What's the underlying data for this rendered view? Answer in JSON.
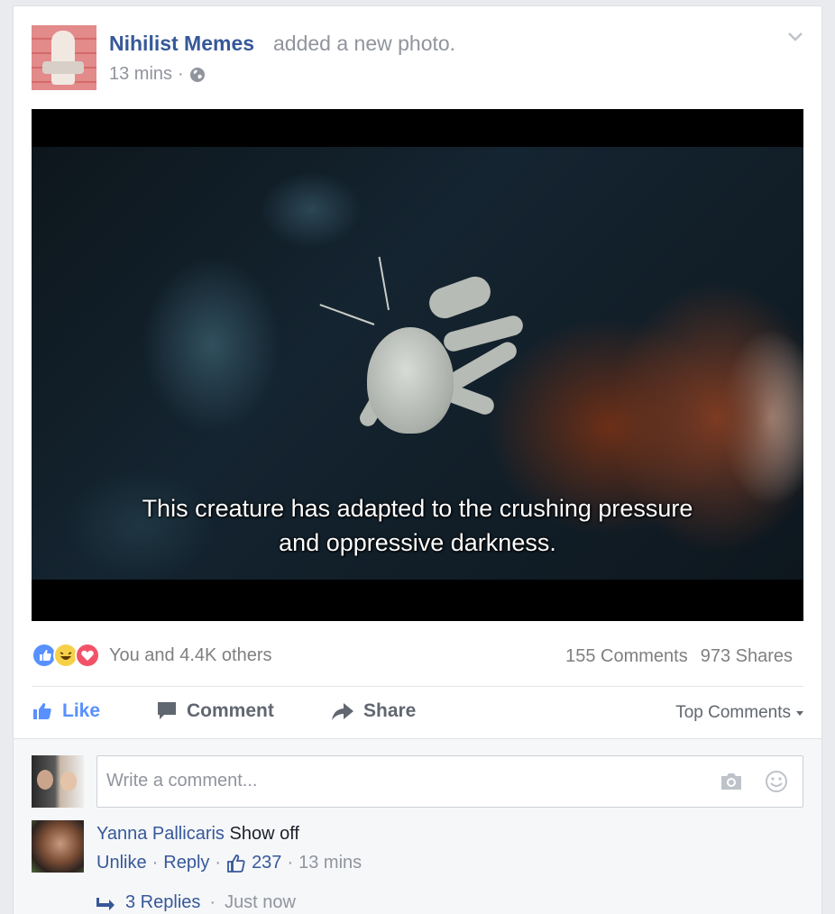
{
  "post": {
    "page_name": "Nihilist Memes",
    "action_text": "added a new photo.",
    "time": "13 mins",
    "dot": "·",
    "privacy_icon": "globe-icon",
    "options_icon": "chevron-down-icon"
  },
  "photo": {
    "caption_line1": "This creature has adapted to the crushing pressure",
    "caption_line2": "and oppressive darkness."
  },
  "reactions": {
    "types": [
      "like",
      "haha",
      "love"
    ],
    "summary": "You and 4.4K others",
    "comments_count": "155 Comments",
    "shares_count": "973 Shares"
  },
  "actions": {
    "like_label": "Like",
    "comment_label": "Comment",
    "share_label": "Share",
    "sort_label": "Top Comments"
  },
  "composer": {
    "placeholder": "Write a comment..."
  },
  "comment": {
    "author": "Yanna Pallicaris",
    "text": "Show off",
    "unlike_label": "Unlike",
    "reply_label": "Reply",
    "likes": "237",
    "time": "13 mins",
    "replies_label": "3 Replies",
    "replies_time": "Just now"
  },
  "colors": {
    "link_blue": "#365899",
    "like_blue": "#5890ff",
    "meta_gray": "#90949c",
    "background": "#e9ebee"
  }
}
